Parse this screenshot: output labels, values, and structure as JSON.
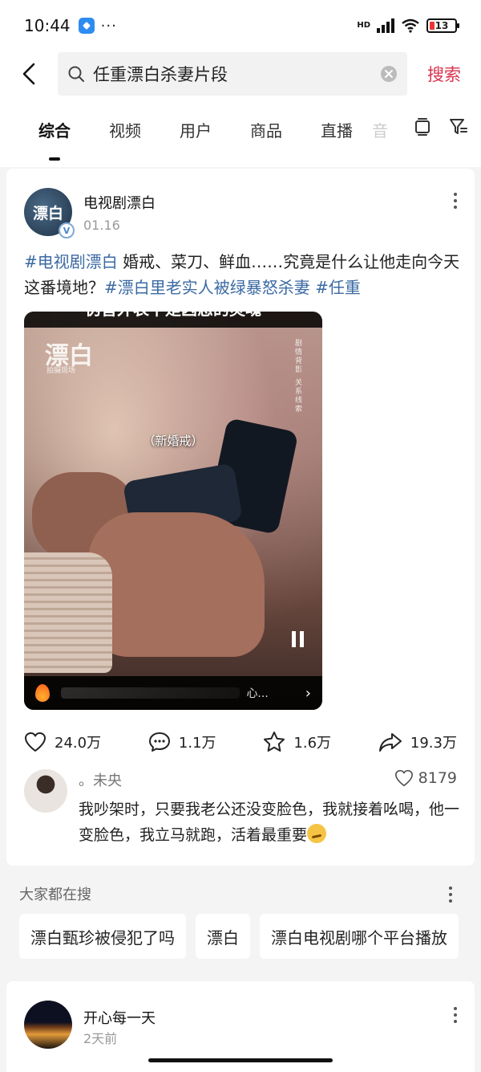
{
  "status_bar": {
    "time": "10:44",
    "more": "···",
    "network": "HD",
    "battery": "13"
  },
  "search": {
    "query": "任重漂白杀妻片段",
    "submit_label": "搜索"
  },
  "tabs": [
    {
      "label": "综合",
      "active": true
    },
    {
      "label": "视频",
      "active": false
    },
    {
      "label": "用户",
      "active": false
    },
    {
      "label": "商品",
      "active": false
    },
    {
      "label": "直播",
      "active": false
    },
    {
      "label": "音",
      "active": false
    }
  ],
  "post": {
    "author_name": "电视剧漂白",
    "avatar_text": "漂白",
    "date": "01.16",
    "text_parts": [
      {
        "text": "#电视剧漂白",
        "hashtag": true
      },
      {
        "text": " 婚戒、菜刀、鲜血……究竟是什么让他走向今天这番境地？",
        "hashtag": false
      },
      {
        "text": "#漂白里老实人被绿暴怒杀妻",
        "hashtag": true
      },
      {
        "text": " ",
        "hashtag": false
      },
      {
        "text": "#任重",
        "hashtag": true
      }
    ],
    "video": {
      "top_caption": "伪善外表下是凶恶的灵魂",
      "logo": "漂白",
      "logo_sub": "拍摄现场",
      "side_text": "剧情背影 关系线索",
      "subtitle": "（新婚戒）",
      "bar_text": "心..."
    },
    "actions": {
      "likes": "24.0万",
      "comments": "1.1万",
      "favorites": "1.6万",
      "shares": "19.3万"
    },
    "top_comment": {
      "user": "。未央",
      "likes": "8179",
      "text": "我吵架时，只要我老公还没变脸色，我就接着吆喝，他一变脸色，我立马就跑，活着最重要"
    }
  },
  "hot_searches": {
    "title": "大家都在搜",
    "items": [
      "漂白甄珍被侵犯了吗",
      "漂白",
      "漂白电视剧哪个平台播放"
    ]
  },
  "next_post": {
    "author_name": "开心每一天",
    "date": "2天前"
  },
  "colors": {
    "accent": "#d8344e",
    "hashtag": "#3b6aa3",
    "background": "#f4f4f4"
  }
}
